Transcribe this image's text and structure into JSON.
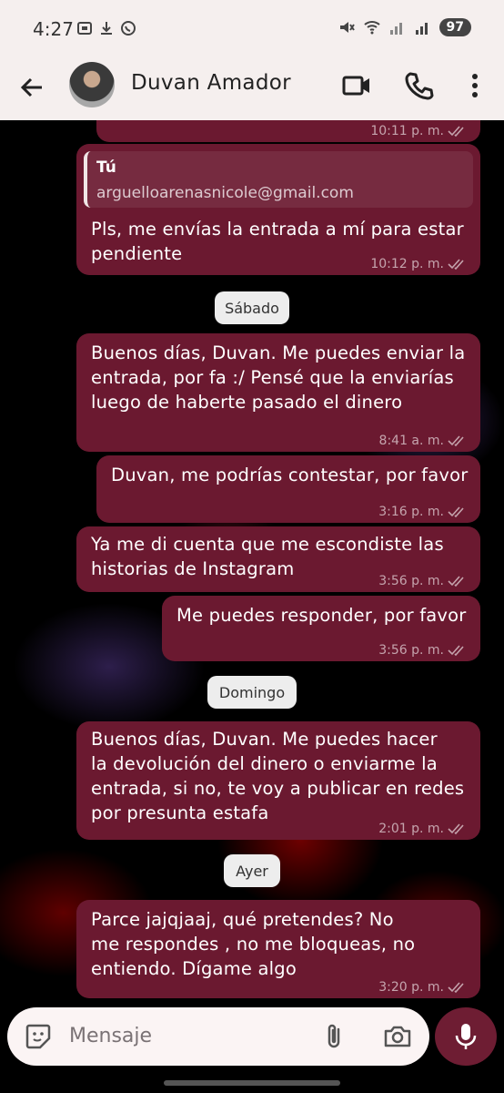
{
  "status_bar": {
    "time": "4:27",
    "battery": "97"
  },
  "header": {
    "contact_name": "Duvan Amador"
  },
  "colors": {
    "bubble": "#6b1930",
    "header_bg": "#f5efee",
    "mic_button": "#6e1d33",
    "chip_bg": "#ededed"
  },
  "messages": [
    {
      "time": "10:11 p. m."
    },
    {
      "quote_author": "Tú",
      "quote_text": "arguelloarenasnicole@gmail.com",
      "lines": [
        "Pls, me envías la entrada a mí para estar",
        "pendiente"
      ],
      "time": "10:12 p. m."
    },
    {
      "lines": [
        "Buenos días, Duvan. Me puedes enviar la",
        "entrada, por fa :/ Pensé que la enviarías",
        "luego de haberte pasado el dinero"
      ],
      "time": "8:41 a. m."
    },
    {
      "lines": [
        "Duvan, me podrías contestar, por favor"
      ],
      "time": "3:16 p. m."
    },
    {
      "lines": [
        "Ya me di cuenta que me escondiste las",
        "historias de Instagram"
      ],
      "time": "3:56 p. m."
    },
    {
      "lines": [
        "Me puedes responder, por favor"
      ],
      "time": "3:56 p. m."
    },
    {
      "lines": [
        "Buenos días, Duvan.  Me puedes hacer",
        "la devolución del dinero o enviarme la",
        "entrada, si no, te voy a publicar en redes",
        "por presunta estafa"
      ],
      "time": "2:01 p. m."
    },
    {
      "lines": [
        "Parce jajqjaaj, qué pretendes? No",
        "me respondes , no me bloqueas, no",
        "entiendo. Dígame algo"
      ],
      "time": "3:20 p. m."
    }
  ],
  "day_separators": [
    "Sábado",
    "Domingo",
    "Ayer"
  ],
  "input": {
    "placeholder": "Mensaje"
  },
  "icons": [
    "back-arrow-icon",
    "video-call-icon",
    "phone-icon",
    "more-options-icon",
    "emoji-sticker-icon",
    "attach-icon",
    "camera-icon",
    "mic-icon",
    "read-ticks-icon"
  ]
}
